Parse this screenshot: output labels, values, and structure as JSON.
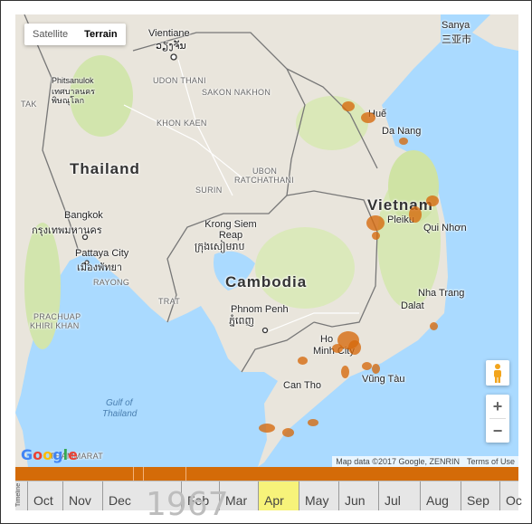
{
  "map": {
    "type_toggle": {
      "satellite": "Satellite",
      "terrain": "Terrain",
      "selected": "Terrain"
    },
    "countries": {
      "thailand": "Thailand",
      "cambodia": "Cambodia",
      "vietnam": "Vietnam"
    },
    "cities": {
      "vientiane": "Vientiane",
      "vientiane_local": "ວຽງຈັນ",
      "bangkok": "Bangkok",
      "bangkok_local": "กรุงเทพมหานคร",
      "pattaya": "Pattaya City",
      "pattaya_local": "เมืองพัทยา",
      "phnom_penh": "Phnom Penh",
      "phnom_penh_local": "ភ្នំពេញ",
      "siem_reap": "Krong Siem Reap",
      "siem_reap_local": "ក្រុងសៀមរាប",
      "sanya": "Sanya",
      "sanya_local": "三亚市",
      "hue": "Huế",
      "da_nang": "Da Nang",
      "pleiku": "Pleiku",
      "qui_nhon": "Qui Nhơn",
      "nha_trang": "Nha Trang",
      "dalat": "Dalat",
      "hcmc_1": "Ho",
      "hcmc_2": "Minh City",
      "vung_tau": "Vũng Tàu",
      "can_tho": "Can Tho",
      "phitsanulok": "Phitsanulok",
      "phitsanulok_local": "เทศบาลนคร พิษณุโลก"
    },
    "provinces": {
      "udon_thani": "UDON THANI",
      "sakon_nakhon": "SAKON NAKHON",
      "khon_kaen": "KHON KAEN",
      "ubon": "UBON",
      "ratchathani": "RATCHATHANI",
      "surin": "SURIN",
      "trat": "TRAT",
      "rayong": "RAYONG",
      "prachuap_1": "PRACHUAP",
      "prachuap_2": "KHIRI KHAN",
      "tak": "TAK",
      "thammarat": "THAMMARAT"
    },
    "sea": {
      "gulf_1": "Gulf of",
      "gulf_2": "Thailand"
    },
    "controls": {
      "zoom_in": "+",
      "zoom_out": "−"
    },
    "attribution": {
      "data": "Map data ©2017 Google, ZENRIN",
      "terms": "Terms of Use"
    },
    "logo": "Google",
    "colors": {
      "water": "#aadaff",
      "land": "#e9e5dc",
      "vegetation": "#cfe3a4",
      "marker": "#d66a0c",
      "timeline_bar": "#d46b08"
    }
  },
  "timeline": {
    "label": "Timeline",
    "year": "1967",
    "months": [
      "Oct",
      "Nov",
      "Dec",
      "Jan",
      "Feb",
      "Mar",
      "Apr",
      "May",
      "Jun",
      "Jul",
      "Aug",
      "Sep",
      "Oc"
    ],
    "highlighted_month": "Apr"
  }
}
